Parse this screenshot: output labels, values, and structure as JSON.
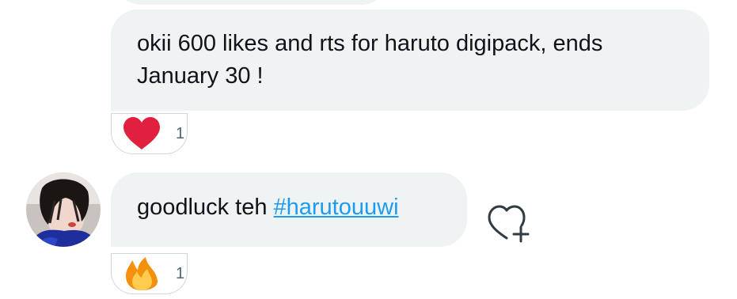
{
  "messages": [
    {
      "text": "okii 600 likes and rts for haruto digipack, ends January 30 !",
      "reaction": {
        "emoji": "heart",
        "count": "1"
      }
    },
    {
      "text_before": "goodluck teh ",
      "hashtag": "#harutouuwi",
      "reaction": {
        "emoji": "fire",
        "count": "1"
      },
      "avatar_icon": "user-avatar",
      "add_reaction_icon": "heart-plus-icon"
    }
  ],
  "colors": {
    "bubble_bg": "#eff3f4",
    "hashtag": "#1d9bf0",
    "heart": "#f91880",
    "text": "#0f1419",
    "muted": "#536471"
  }
}
